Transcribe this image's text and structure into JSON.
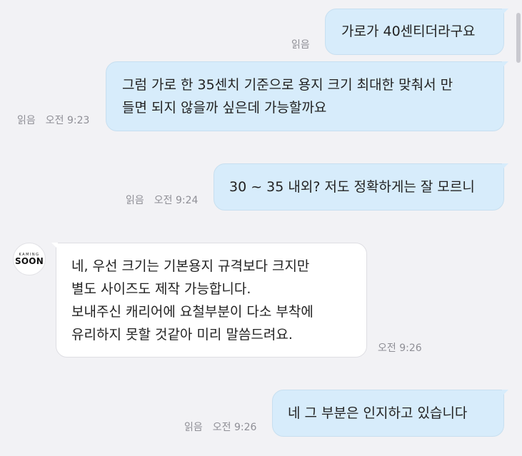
{
  "avatar": {
    "brand_top": "KAMING",
    "brand_bottom": "SOON"
  },
  "messages": [
    {
      "lines": [
        "가로가 40센티더라구요"
      ],
      "read": "읽음",
      "time": ""
    },
    {
      "lines": [
        "그럼 가로 한 35센치 기준으로 용지 크기 최대한 맞춰서 만",
        "들면 되지 않을까 싶은데 가능할까요"
      ],
      "read": "읽음",
      "time": "오전 9:23"
    },
    {
      "lines": [
        "30 ~ 35 내외? 저도 정확하게는 잘 모르니"
      ],
      "read": "읽음",
      "time": "오전 9:24"
    },
    {
      "lines": [
        "네, 우선 크기는 기본용지 규격보다 크지만",
        "별도 사이즈도 제작 가능합니다.",
        "보내주신 캐리어에 요철부분이 다소 부착에",
        "유리하지 못할 것같아 미리 말씀드려요."
      ],
      "time": "오전 9:26"
    },
    {
      "lines": [
        "네 그 부분은 인지하고 있습니다"
      ],
      "read": "읽음",
      "time": "오전 9:26"
    }
  ]
}
